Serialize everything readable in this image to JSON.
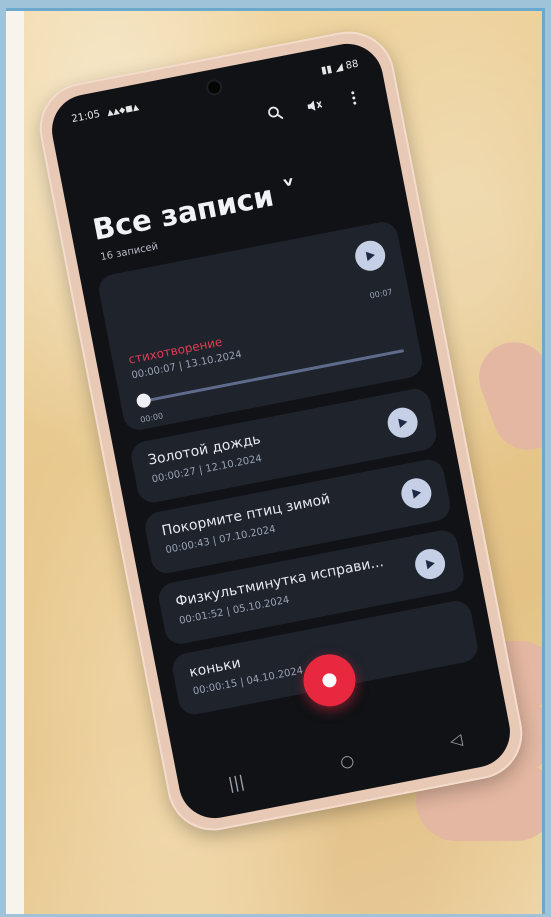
{
  "status_bar": {
    "time": "21:05",
    "notifications": "▲▲◆■▲",
    "indicators": "▮▮ ◢ 88"
  },
  "app_bar": {
    "icons": [
      "search-icon",
      "waveform-icon",
      "more-vert-icon"
    ]
  },
  "header": {
    "title": "Все записи ˅",
    "count": "16 записей"
  },
  "active_recording": {
    "name": "стихотворение",
    "meta": "00:00:07 | 13.10.2024",
    "position_label": "00:00",
    "duration_label": "00:07",
    "progress": 0.0,
    "accent": "#e23b52"
  },
  "recordings": [
    {
      "name": "Золотой дождь",
      "meta": "00:00:27 | 12.10.2024"
    },
    {
      "name": "Покормите птиц зимой",
      "meta": "00:00:43 | 07.10.2024"
    },
    {
      "name": "Физкультминутка исправи...",
      "meta": "00:01:52 | 05.10.2024"
    },
    {
      "name": "коньки",
      "meta": "00:00:15 | 04.10.2024"
    }
  ],
  "colors": {
    "record_button": "#e8283f",
    "play_button": "#c5cfe6",
    "card": "#1e232c"
  }
}
